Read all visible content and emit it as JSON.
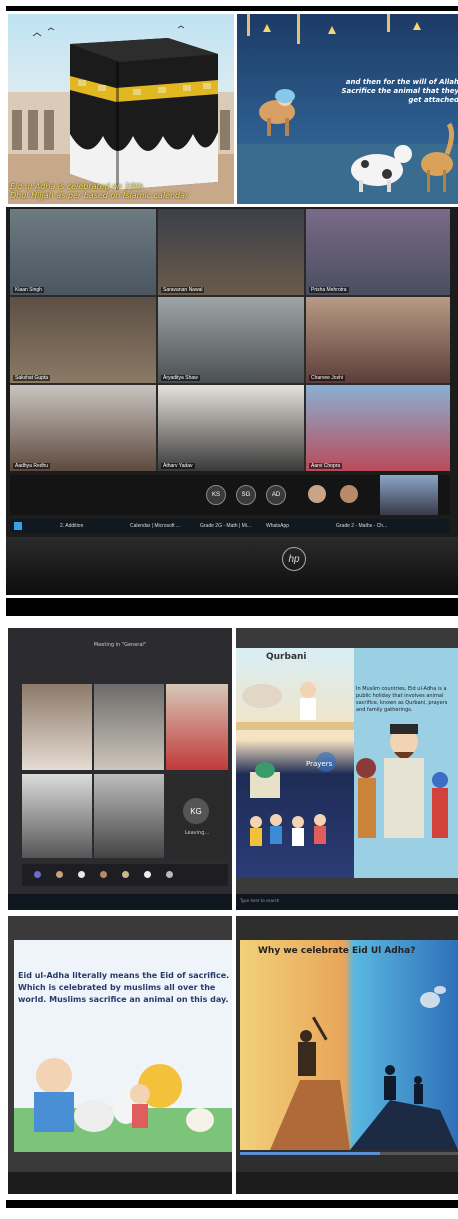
{
  "panel1": {
    "caption": "Eid ul Adha is celebrated on 10th\nDhul Hijjah as per based on Islamic calendar"
  },
  "panel2": {
    "caption": "and then for the will of Allah\nSacrifice the animal that they get attached"
  },
  "zoom": {
    "participants": [
      "Kiaan Singh",
      "Saravanan Nawal",
      "Prisha Mehrotra",
      "Sakshat Gupta",
      "Aryaditya Shaw",
      "Charvee Joshi",
      "Aadhya Redhu",
      "Atharv Yadav",
      "Aarvi Chopra"
    ],
    "bottom_avatars": [
      "KS",
      "SG",
      "AD"
    ],
    "taskbar": [
      "2. Addition",
      "Calendar | Microsoft ...",
      "Grade 2G - Math | Mi...",
      "WhatsApp",
      "Grade 2 - Maths - Ch..."
    ],
    "laptop_brand": "hp"
  },
  "teams": {
    "title": "Meeting in \"General\"",
    "avatar_initials": "KG",
    "avatar_status": "Leaving...",
    "search_placeholder": "Type here to search"
  },
  "slide_qurbani": {
    "heading": "Qurbani",
    "label_prayers": "Prayers",
    "text": "In Muslim countries, Eid ul-Adha is a public holiday that involves animal sacrifice, known as Qurbani, prayers and family gatherings."
  },
  "slide_meaning": {
    "text": "Eid ul-Adha literally means the Eid of sacrifice. Which is celebrated by muslims all over the world. Muslims sacrifice an animal on this day."
  },
  "slide_why": {
    "title": "Why we celebrate Eid Ul Adha?"
  }
}
